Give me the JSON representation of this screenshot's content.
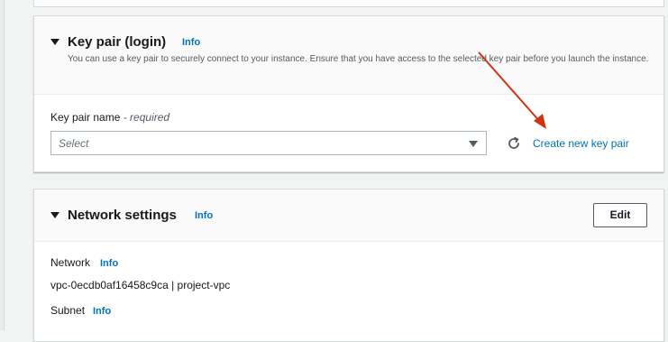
{
  "key_pair_section": {
    "title": "Key pair (login)",
    "info_label": "Info",
    "description": "You can use a key pair to securely connect to your instance. Ensure that you have access to the selected key pair before you launch the instance.",
    "field_label": "Key pair name",
    "field_required": "- required",
    "select_placeholder": "Select",
    "create_link": "Create new key pair"
  },
  "network_section": {
    "title": "Network settings",
    "info_label": "Info",
    "edit_button": "Edit",
    "network_label": "Network",
    "network_info": "Info",
    "network_value": "vpc-0ecdb0af16458c9ca | project-vpc",
    "subnet_label": "Subnet",
    "subnet_info": "Info"
  },
  "colors": {
    "link": "#0073bb",
    "annotation_arrow": "#d13212",
    "panel_bg": "#ffffff",
    "page_bg": "#f2f3f3"
  },
  "icons": {
    "section_toggle": "caret-down-icon",
    "refresh": "refresh-icon",
    "select_dropdown": "chevron-down-icon"
  }
}
